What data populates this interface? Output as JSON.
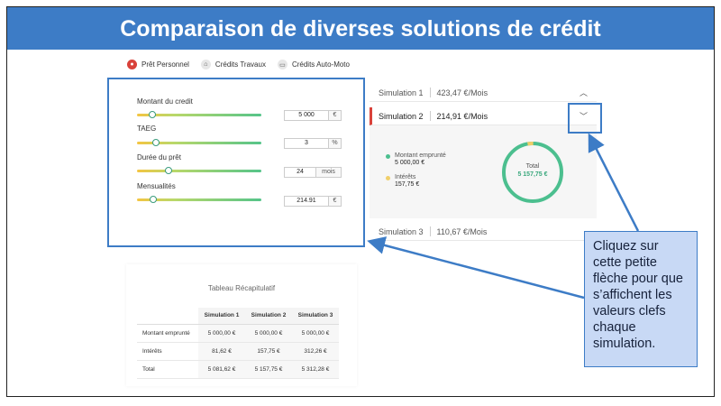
{
  "banner": {
    "title": "Comparaison de diverses solutions de crédit"
  },
  "tabs": [
    {
      "label": "Prêt Personnel",
      "icon": "person-icon",
      "active": true
    },
    {
      "label": "Crédits Travaux",
      "icon": "home-icon",
      "active": false
    },
    {
      "label": "Crédits Auto-Moto",
      "icon": "car-icon",
      "active": false
    }
  ],
  "calculator": {
    "fields": [
      {
        "label": "Montant du credit",
        "value": "5 000",
        "unit": "€",
        "level": 0.12
      },
      {
        "label": "TAEG",
        "value": "3",
        "unit": "%",
        "level": 0.15
      },
      {
        "label": "Durée du prêt",
        "value": "24",
        "unit": "mois",
        "level": 0.25
      },
      {
        "label": "Mensualités",
        "value": "214.91",
        "unit": "€",
        "level": 0.13
      }
    ]
  },
  "simulations": [
    {
      "name": "Simulation 1",
      "amount": "423,47 €/Mois",
      "expanded": false
    },
    {
      "name": "Simulation 2",
      "amount": "214,91 €/Mois",
      "expanded": true
    },
    {
      "name": "Simulation 3",
      "amount": "110,67 €/Mois",
      "expanded": false
    }
  ],
  "simulation_detail": {
    "legend": [
      {
        "label": "Montant emprunté",
        "value": "5 000,00 €",
        "color": "#4cbf8f"
      },
      {
        "label": "Intérêts",
        "value": "157,75 €",
        "color": "#f0cf6a"
      }
    ],
    "total_label": "Total",
    "total_value": "5 157,75 €",
    "interest_fraction": 0.031
  },
  "summary": {
    "title": "Tableau Récapitulatif",
    "columns": [
      "Simulation 1",
      "Simulation 2",
      "Simulation 3"
    ],
    "rows": [
      {
        "label": "Montant emprunté",
        "values": [
          "5 000,00 €",
          "5 000,00 €",
          "5 000,00 €"
        ]
      },
      {
        "label": "Intérêts",
        "values": [
          "81,62 €",
          "157,75 €",
          "312,26 €"
        ]
      },
      {
        "label": "Total",
        "values": [
          "5 081,62 €",
          "5 157,75 €",
          "5 312,28 €"
        ]
      }
    ]
  },
  "callout": {
    "text": "Cliquez sur cette petite flèche pour que s’affichent les valeurs clefs chaque simulation."
  },
  "colors": {
    "accent": "#3d7cc6",
    "active": "#d9423a",
    "green": "#4cbf8f",
    "yellow": "#f0cf6a"
  }
}
